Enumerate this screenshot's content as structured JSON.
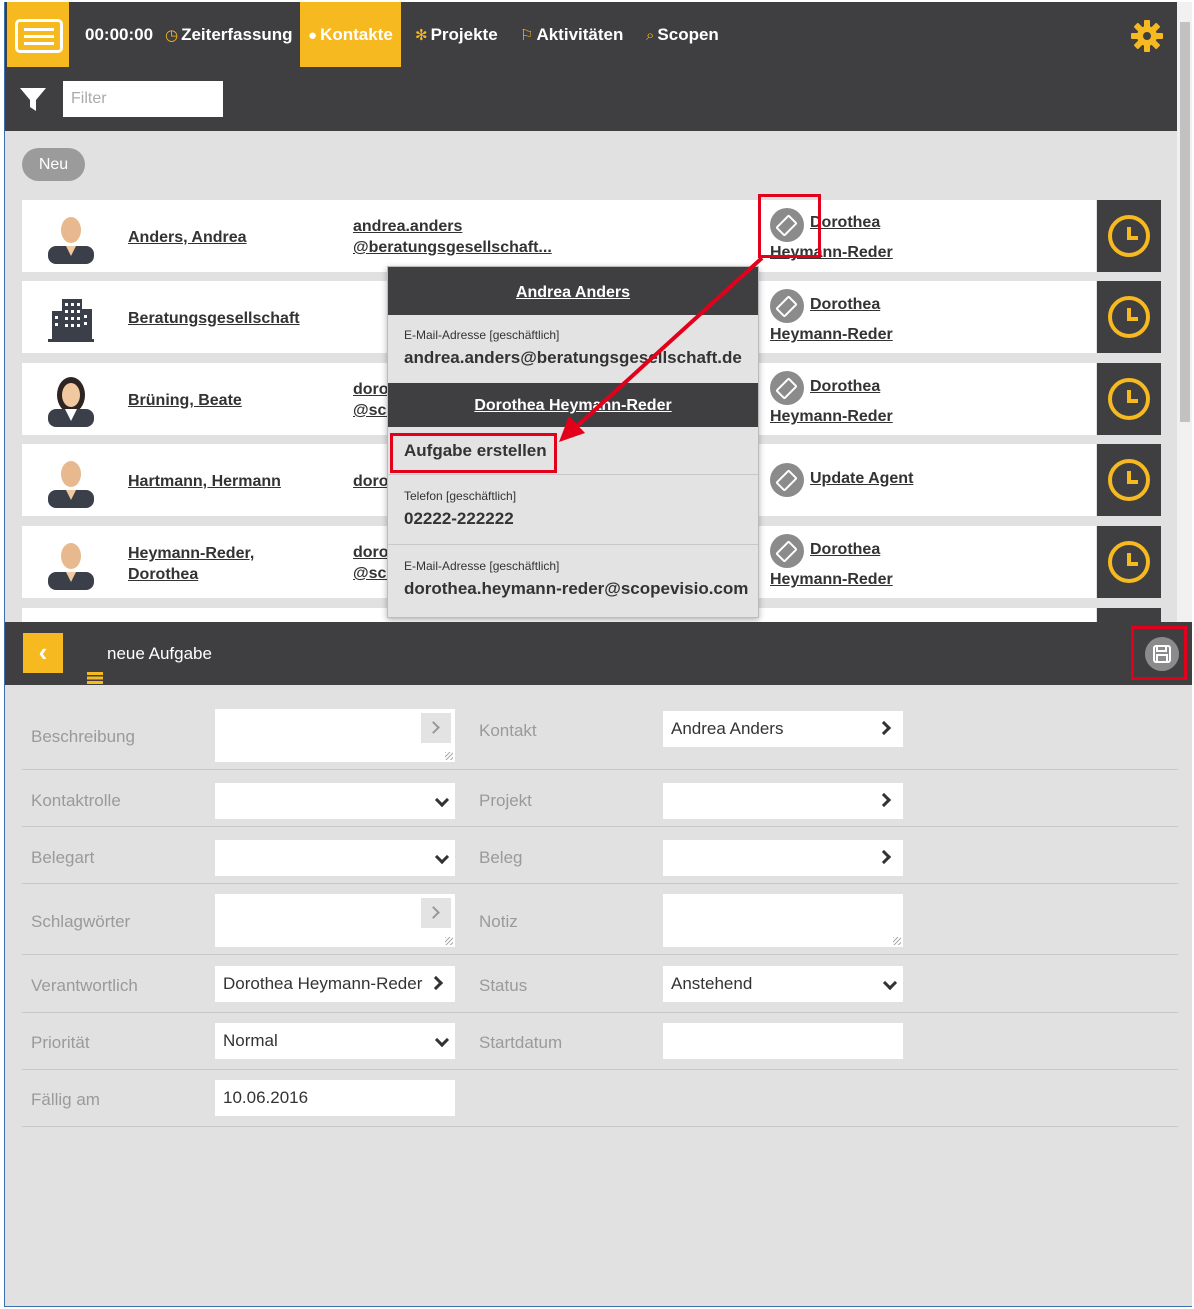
{
  "nav": {
    "timer": "00:00:00",
    "items": [
      {
        "label": "Zeiterfassung",
        "icon": "clock-icon"
      },
      {
        "label": "Kontakte",
        "icon": "person-icon",
        "active": true
      },
      {
        "label": "Projekte",
        "icon": "cogs-icon"
      },
      {
        "label": "Aktivitäten",
        "icon": "flag-icon"
      },
      {
        "label": "Scopen",
        "icon": "search-icon"
      }
    ],
    "settings_icon": "gear-icon"
  },
  "filter": {
    "placeholder": "Filter"
  },
  "new_button": "Neu",
  "contacts": [
    {
      "name": "Anders, Andrea",
      "email_line1": "andrea.anders",
      "email_line2": "@beratungsgesellschaft...",
      "responsible_line1": "Dorothea",
      "responsible_line2": "Heymann-Reder",
      "avatar": "male-avatar-icon"
    },
    {
      "name": "Beratungsgesellschaft",
      "email_line1": "",
      "email_line2": "",
      "responsible_line1": "Dorothea",
      "responsible_line2": "Heymann-Reder",
      "avatar": "building-icon"
    },
    {
      "name": "Brüning, Beate",
      "email_line1": "doro",
      "email_line2": "@sco",
      "responsible_line1": "Dorothea",
      "responsible_line2": "Heymann-Reder",
      "avatar": "female-avatar-icon"
    },
    {
      "name": "Hartmann, Hermann",
      "email_line1": "doro",
      "email_line2": "",
      "responsible_line1": "Update Agent",
      "responsible_line2": "",
      "avatar": "male-avatar-icon"
    },
    {
      "name": "Heymann-Reder,",
      "name_line2": "Dorothea",
      "email_line1": "doro",
      "email_line2": "@sco",
      "responsible_line1": "Dorothea",
      "responsible_line2": "Heymann-Reder",
      "avatar": "male-avatar-icon"
    }
  ],
  "popup": {
    "contact_title": "Andrea Anders",
    "email_label": "E-Mail-Adresse [geschäftlich]",
    "email_value": "andrea.anders@beratungsgesellschaft.de",
    "person_title": "Dorothea Heymann-Reder",
    "create_task": "Aufgabe erstellen",
    "phone_label": "Telefon [geschäftlich]",
    "phone_value": "02222-222222",
    "email2_label": "E-Mail-Adresse [geschäftlich]",
    "email2_value": "dorothea.heymann-reder@scopevisio.com"
  },
  "task": {
    "title": "neue Aufgabe",
    "fields": {
      "beschreibung": {
        "label": "Beschreibung",
        "value": ""
      },
      "kontakt": {
        "label": "Kontakt",
        "value": "Andrea Anders"
      },
      "kontaktrolle": {
        "label": "Kontaktrolle",
        "value": ""
      },
      "projekt": {
        "label": "Projekt",
        "value": ""
      },
      "belegart": {
        "label": "Belegart",
        "value": ""
      },
      "beleg": {
        "label": "Beleg",
        "value": ""
      },
      "schlagwoerter": {
        "label": "Schlagwörter",
        "value": ""
      },
      "notiz": {
        "label": "Notiz",
        "value": ""
      },
      "verantwortlich": {
        "label": "Verantwortlich",
        "value": "Dorothea Heymann-Reder"
      },
      "status": {
        "label": "Status",
        "value": "Anstehend"
      },
      "prioritaet": {
        "label": "Priorität",
        "value": "Normal"
      },
      "startdatum": {
        "label": "Startdatum",
        "value": ""
      },
      "faellig": {
        "label": "Fällig am",
        "value": "10.06.2016"
      }
    }
  },
  "colors": {
    "accent": "#f6b91f",
    "dark": "#3f3f42",
    "highlight": "#e3001b"
  }
}
